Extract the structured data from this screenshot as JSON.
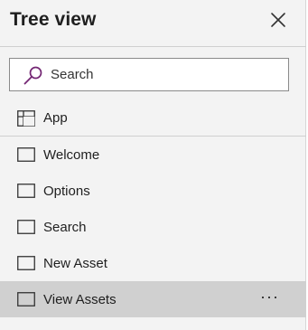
{
  "panel": {
    "title": "Tree view",
    "close_icon": "close-icon"
  },
  "search": {
    "placeholder": "Search",
    "icon": "search-icon",
    "accent_color": "#742774"
  },
  "app_item": {
    "label": "App",
    "icon": "app-grid-icon"
  },
  "screens": [
    {
      "label": "Welcome",
      "icon": "screen-icon",
      "selected": false
    },
    {
      "label": "Options",
      "icon": "screen-icon",
      "selected": false
    },
    {
      "label": "Search",
      "icon": "screen-icon",
      "selected": false
    },
    {
      "label": "New Asset",
      "icon": "screen-icon",
      "selected": false
    },
    {
      "label": "View Assets",
      "icon": "screen-icon",
      "selected": true
    }
  ],
  "selected_row_menu": {
    "label": "···",
    "icon": "more-options-icon"
  }
}
